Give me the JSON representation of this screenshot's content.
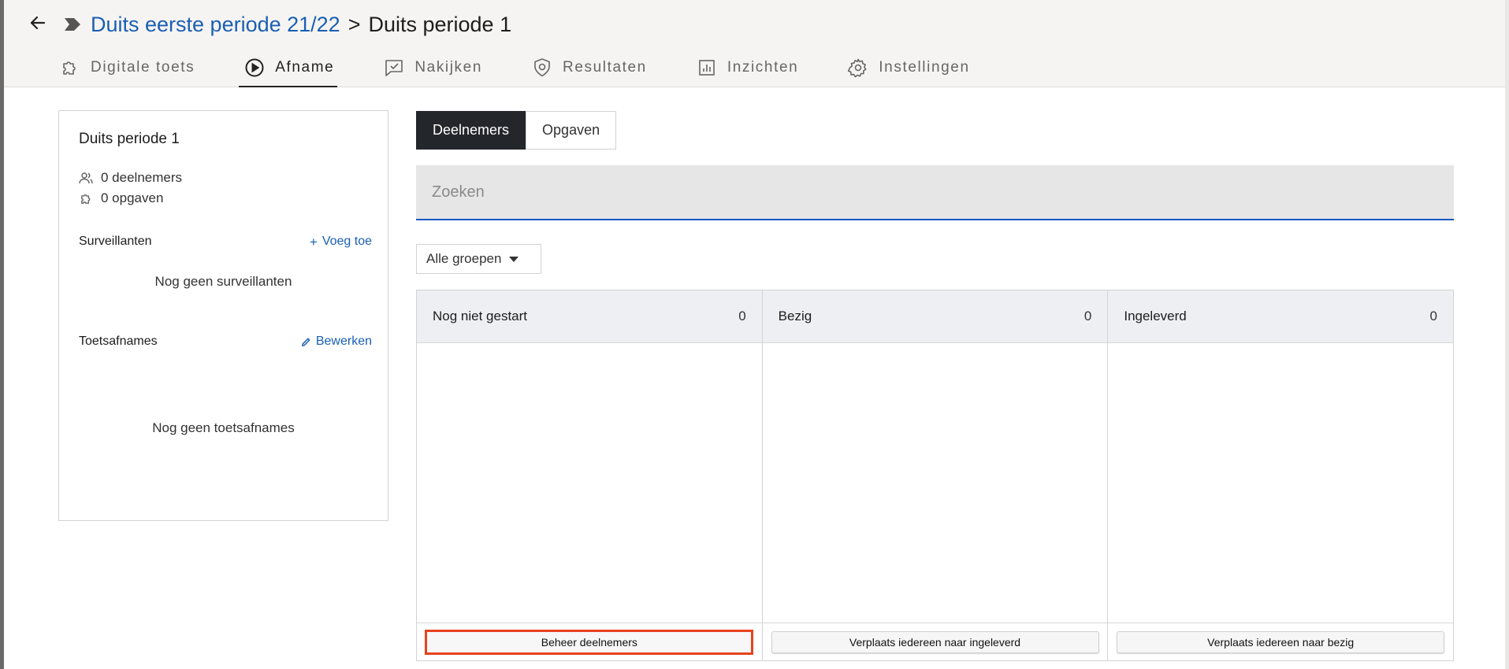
{
  "header": {
    "breadcrumb_link": "Duits eerste periode 21/22",
    "breadcrumb_sep": ">",
    "breadcrumb_current": "Duits periode 1"
  },
  "tabs": [
    {
      "label": "Digitale toets",
      "icon": "puzzle-icon"
    },
    {
      "label": "Afname",
      "icon": "play-circle-icon",
      "active": true
    },
    {
      "label": "Nakijken",
      "icon": "message-check-icon"
    },
    {
      "label": "Resultaten",
      "icon": "shield-icon"
    },
    {
      "label": "Inzichten",
      "icon": "bar-chart-icon"
    },
    {
      "label": "Instellingen",
      "icon": "gear-icon"
    }
  ],
  "sidebar": {
    "title": "Duits periode 1",
    "participants": "0 deelnemers",
    "questions": "0 opgaven",
    "surveillants_title": "Surveillanten",
    "surveillants_action": "Voeg toe",
    "surveillants_empty": "Nog geen surveillanten",
    "sessions_title": "Toetsafnames",
    "sessions_action": "Bewerken",
    "sessions_empty": "Nog geen toetsafnames"
  },
  "main": {
    "segments": [
      "Deelnemers",
      "Opgaven"
    ],
    "search_placeholder": "Zoeken",
    "group_filter": "Alle groepen",
    "columns": [
      {
        "title": "Nog niet gestart",
        "count": "0",
        "button": "Beheer deelnemers"
      },
      {
        "title": "Bezig",
        "count": "0",
        "button": "Verplaats iedereen naar ingeleverd"
      },
      {
        "title": "Ingeleverd",
        "count": "0",
        "button": "Verplaats iedereen naar bezig"
      }
    ]
  },
  "colors": {
    "link": "#1a5fb4",
    "active_segment": "#23262b",
    "highlight_border": "#e8431f",
    "search_underline": "#1a56c4"
  }
}
